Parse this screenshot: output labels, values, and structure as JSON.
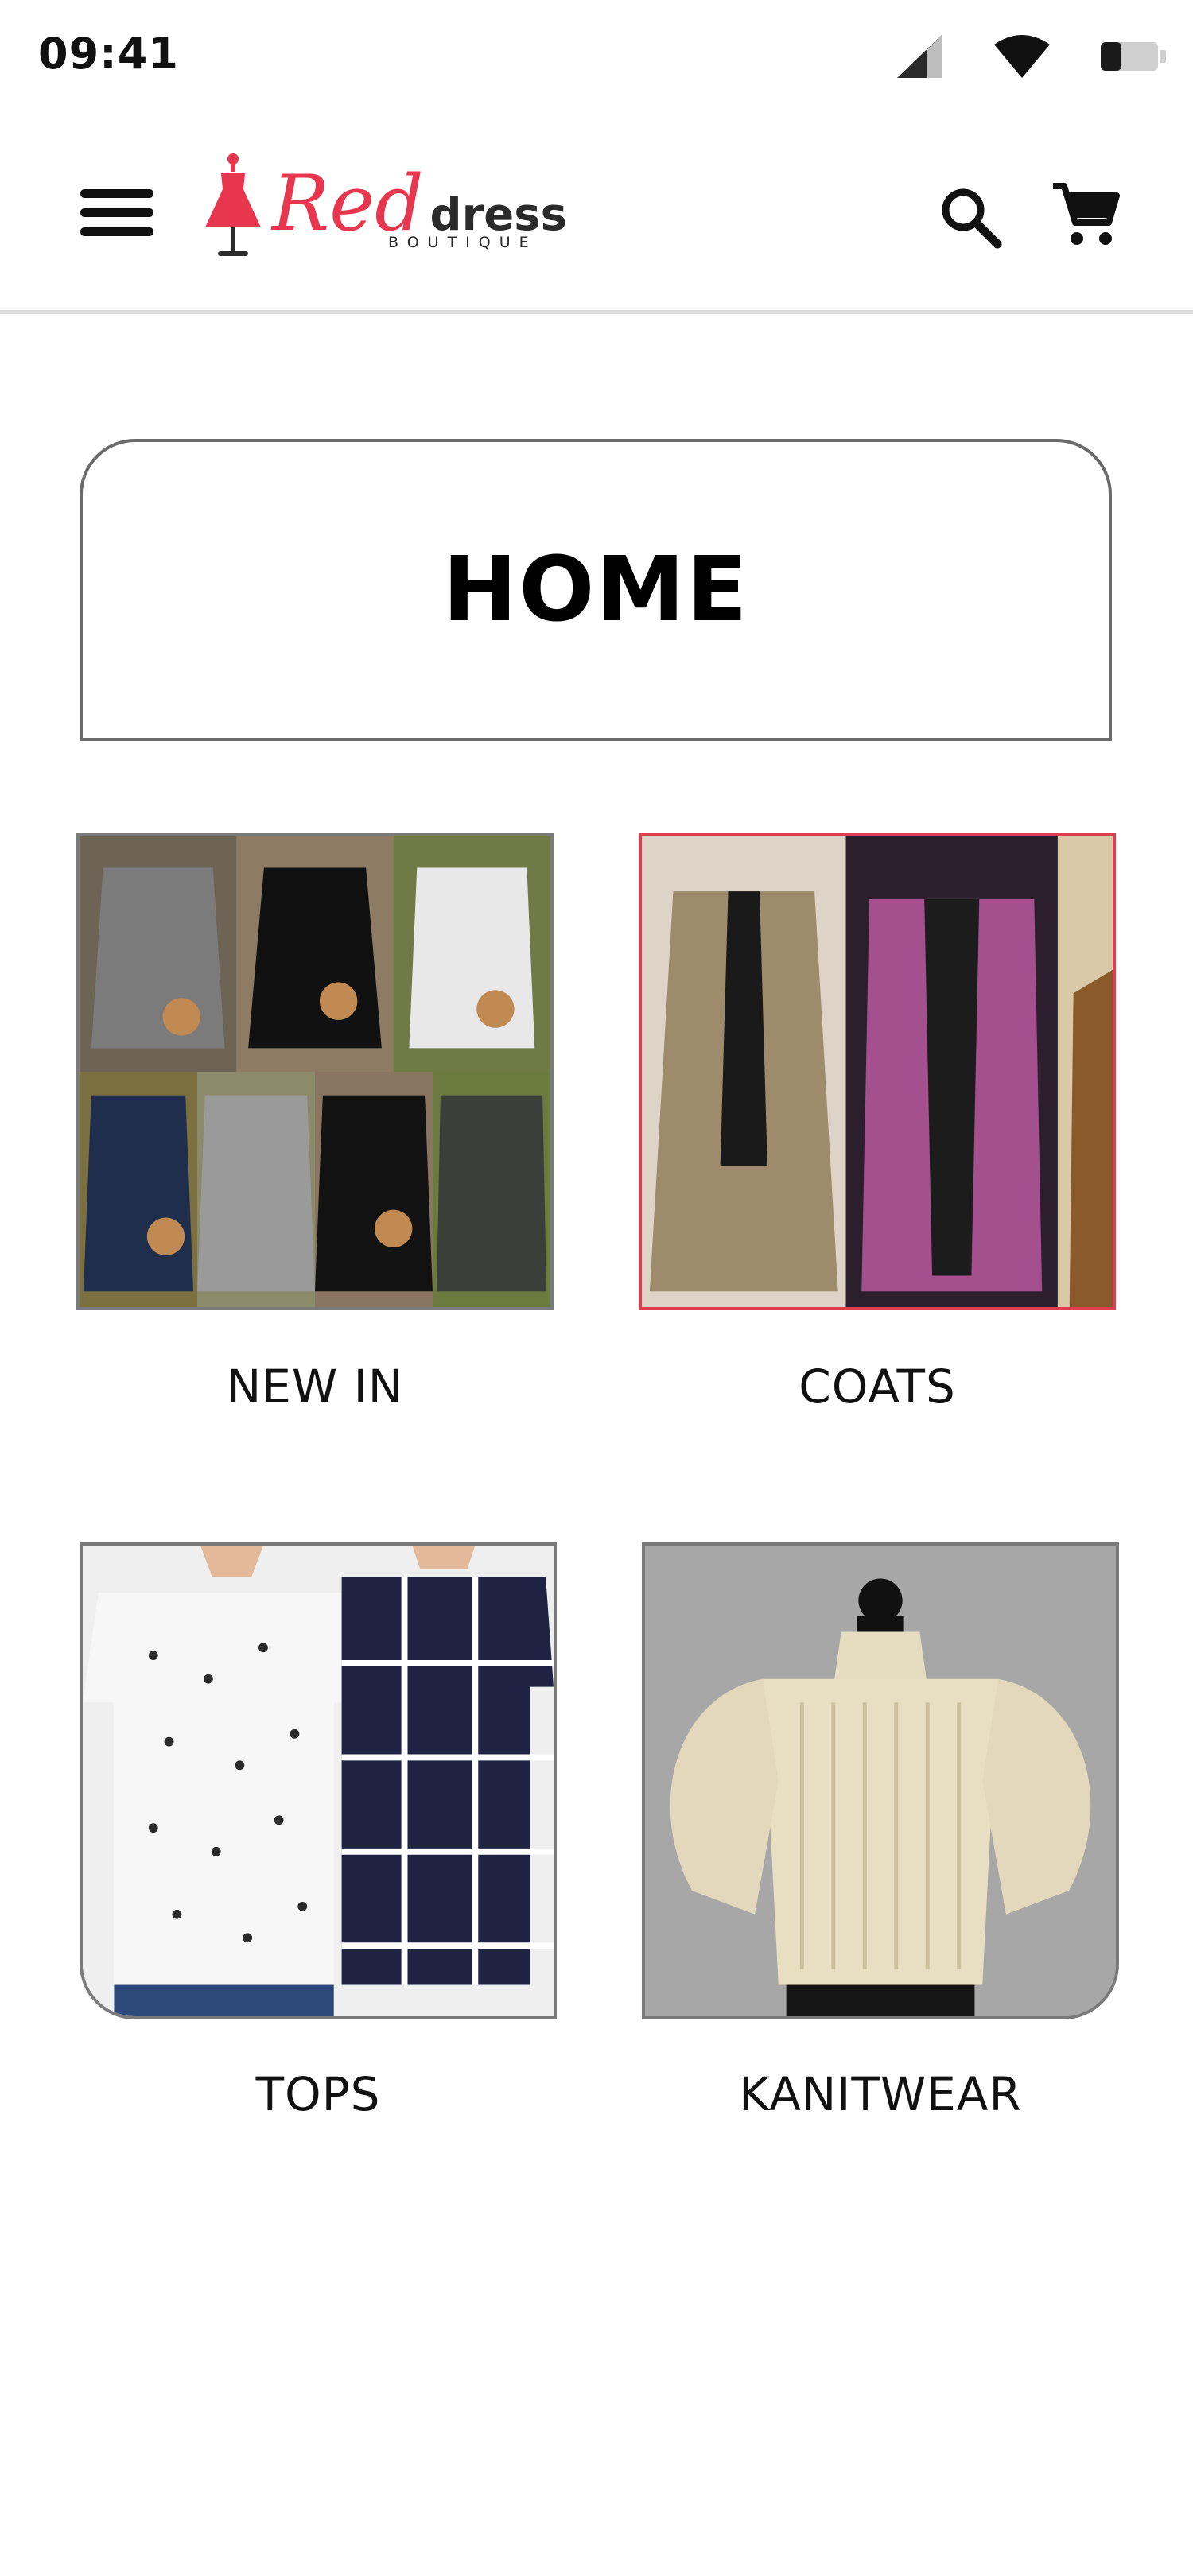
{
  "status_bar": {
    "time": "09:41",
    "icons": [
      "signal-icon",
      "wifi-icon",
      "battery-icon"
    ]
  },
  "app_bar": {
    "menu_icon": "hamburger-menu-icon",
    "logo": {
      "word_red": "Red",
      "word_dress": "dress",
      "tagline": "BOUTIQUE"
    },
    "search_icon": "search-icon",
    "cart_icon": "shopping-cart-icon"
  },
  "banner": {
    "title": "HOME"
  },
  "categories": [
    {
      "label": "NEW IN"
    },
    {
      "label": "COATS"
    },
    {
      "label": "TOPS"
    },
    {
      "label": "KANITWEAR"
    }
  ],
  "colors": {
    "brand_red": "#e8364e",
    "selected_border": "#e23d4f",
    "border_gray": "#6b6b6b",
    "divider": "#dcdcdc"
  }
}
